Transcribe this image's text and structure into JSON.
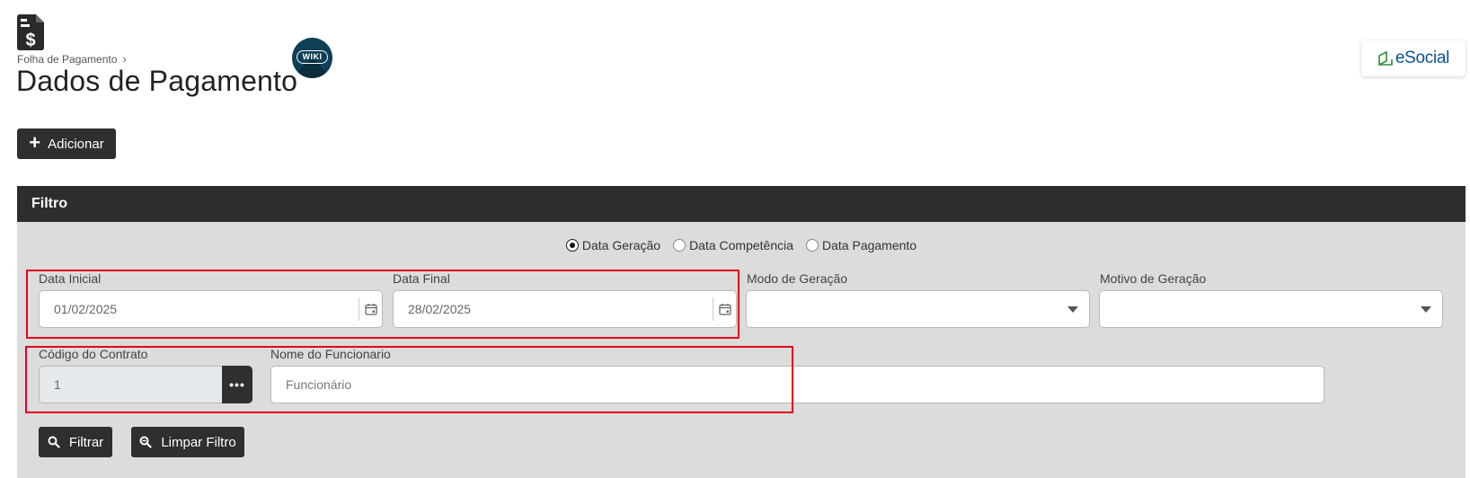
{
  "header": {
    "breadcrumb": [
      "Folha de Pagamento"
    ],
    "breadcrumb_separator": "›",
    "title": "Dados de Pagamento",
    "wiki_label": "WIKI",
    "esocial_label": "eSocial"
  },
  "actions": {
    "add_label": "Adicionar"
  },
  "filter": {
    "title": "Filtro",
    "date_type_options": [
      {
        "label": "Data Geração",
        "selected": true
      },
      {
        "label": "Data Competência",
        "selected": false
      },
      {
        "label": "Data Pagamento",
        "selected": false
      }
    ],
    "data_inicial": {
      "label": "Data Inicial",
      "value": "01/02/2025"
    },
    "data_final": {
      "label": "Data Final",
      "value": "28/02/2025"
    },
    "modo_geracao": {
      "label": "Modo de Geração",
      "value": ""
    },
    "motivo_geracao": {
      "label": "Motivo de Geração",
      "value": ""
    },
    "codigo_contrato": {
      "label": "Código do Contrato",
      "value": "1"
    },
    "nome_funcionario": {
      "label": "Nome do Funcionario",
      "placeholder": "Funcionário",
      "value": ""
    },
    "filter_button": "Filtrar",
    "clear_button": "Limpar Filtro"
  },
  "colors": {
    "dark_button": "#2f2f2f",
    "panel_bg": "#dcdcdc",
    "header_bg": "#2d2d2d",
    "highlight": "#e3001b",
    "esocial_blue": "#0b5394",
    "wiki_bg": "#0e3f57"
  }
}
